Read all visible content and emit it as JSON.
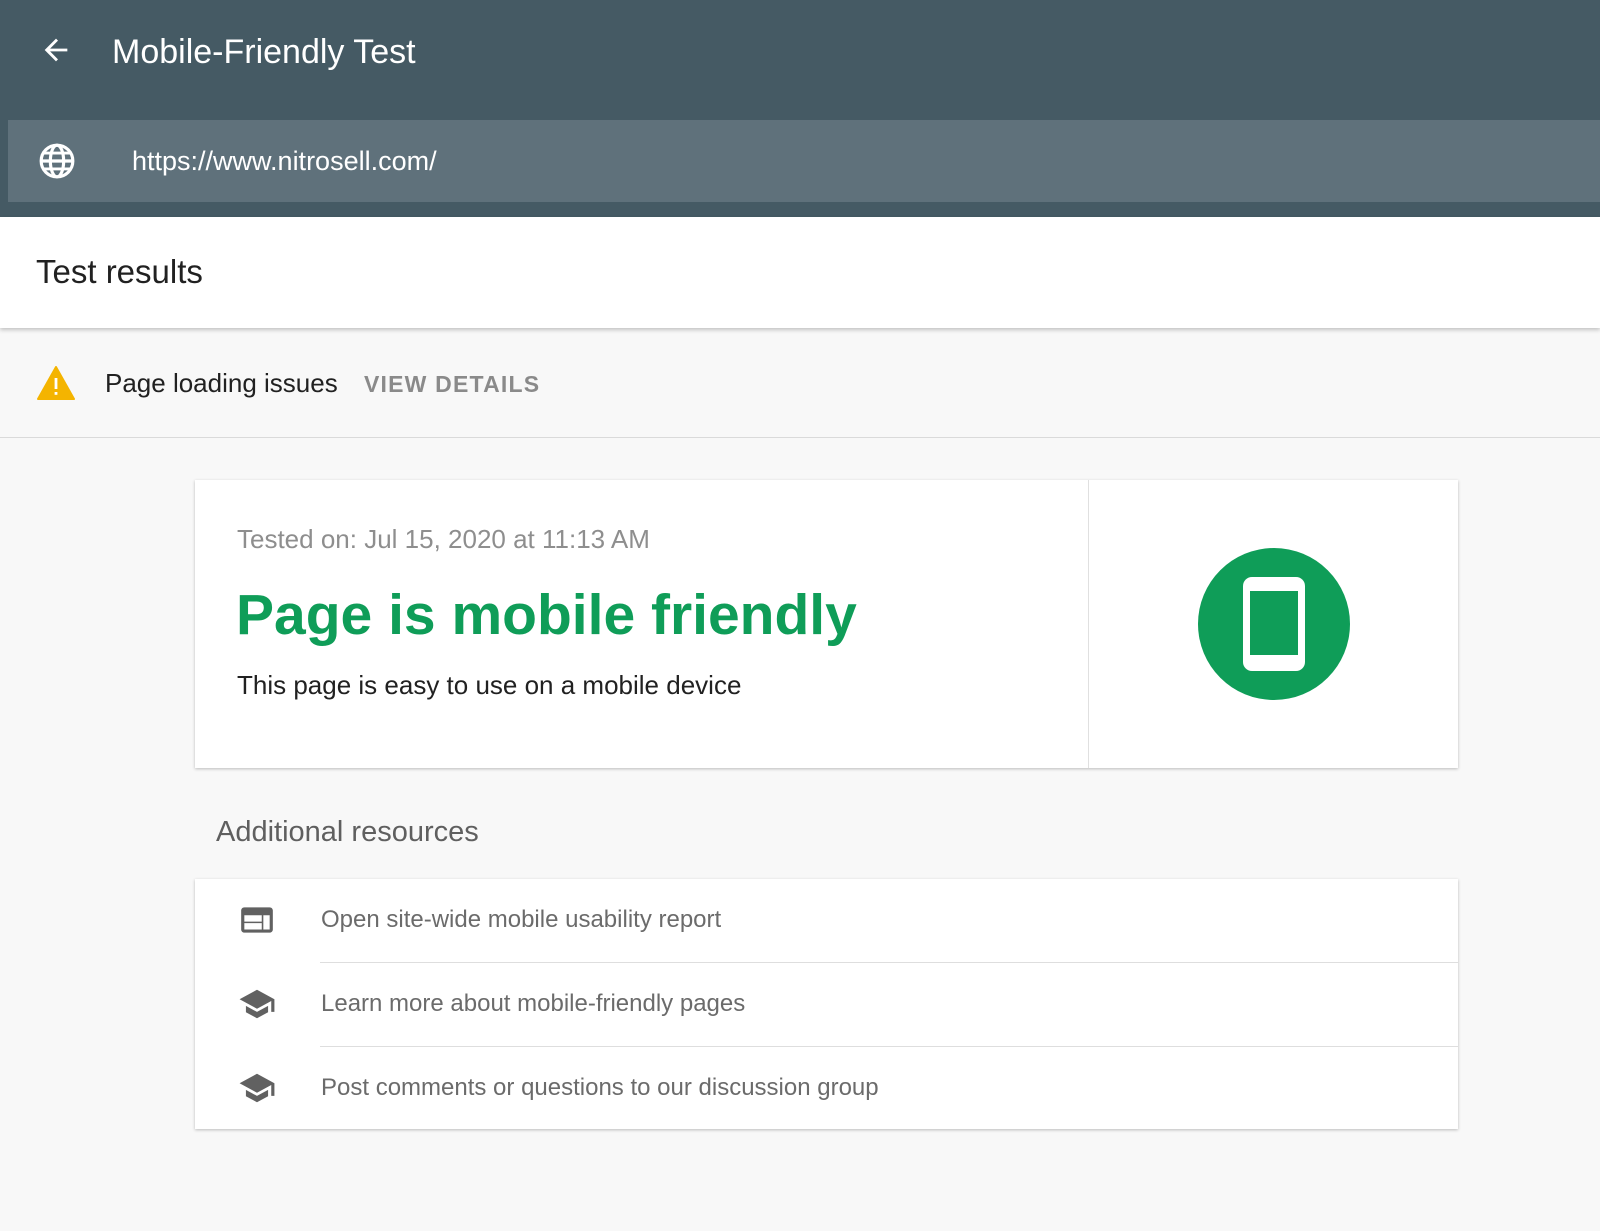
{
  "header": {
    "title": "Mobile-Friendly Test",
    "back_icon": "arrow-back-icon",
    "url_value": "https://www.nitrosell.com/",
    "url_icon": "globe-icon",
    "bg_color": "#455a64"
  },
  "results": {
    "title": "Test results"
  },
  "issues": {
    "icon": "warning-icon",
    "label": "Page loading issues",
    "action": "VIEW DETAILS"
  },
  "result_card": {
    "tested_on": "Tested on: Jul 15, 2020 at 11:13 AM",
    "verdict": "Page is mobile friendly",
    "description": "This page is easy to use on a mobile device",
    "verdict_color": "#0f9d58",
    "badge_icon": "smartphone-icon"
  },
  "resources": {
    "title": "Additional resources",
    "items": [
      {
        "label": "Open site-wide mobile usability report",
        "icon": "web-report-icon"
      },
      {
        "label": "Learn more about mobile-friendly pages",
        "icon": "school-icon"
      },
      {
        "label": "Post comments or questions to our discussion group",
        "icon": "school-icon"
      }
    ]
  }
}
